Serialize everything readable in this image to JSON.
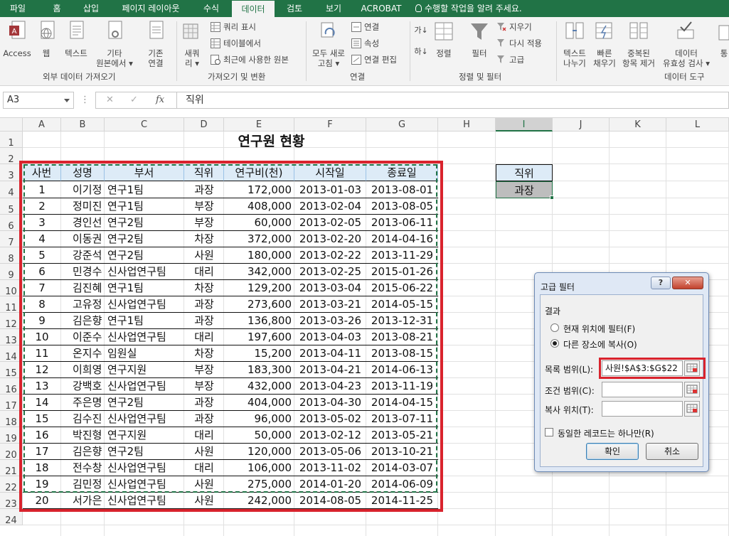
{
  "ribbon": {
    "tabs": [
      "파일",
      "홈",
      "삽입",
      "페이지 레이아웃",
      "수식",
      "데이터",
      "검토",
      "보기",
      "ACROBAT",
      "수행할 작업을 알려 주세요."
    ],
    "active_tab": "데이터",
    "groups": {
      "external": {
        "label": "외부 데이터 가져오기",
        "access": "Access",
        "web": "웹",
        "text": "텍스트",
        "other_line1": "기타",
        "other_line2": "원본에서 ▾"
      },
      "existing": {
        "line1": "기존",
        "line2": "연결"
      },
      "getdata": {
        "label": "가져오기 및 변환",
        "new_query_line1": "새쿼",
        "new_query_line2": "리 ▾",
        "show_queries": "쿼리 표시",
        "from_table": "테이블에서",
        "recent_sources": "최근에 사용한 원본"
      },
      "connections": {
        "label": "연결",
        "refresh_line1": "모두 새로",
        "refresh_line2": "고침 ▾",
        "connections": "연결",
        "properties": "속성",
        "edit_links": "연결 편집"
      },
      "sortfilter": {
        "label": "정렬 및 필터",
        "sort": "정렬",
        "filter": "필터",
        "clear": "지우기",
        "reapply": "다시 적용",
        "advanced": "고급"
      },
      "datatools": {
        "label": "데이터 도구",
        "text_to_cols_line1": "텍스트",
        "text_to_cols_line2": "나누기",
        "flash_fill_line1": "빠른",
        "flash_fill_line2": "채우기",
        "remove_dup_line1": "중복된",
        "remove_dup_line2": "항목 제거",
        "validation_line1": "데이터",
        "validation_line2": "유효성 검사 ▾",
        "consolidate": "통"
      }
    }
  },
  "formula_bar": {
    "name_box": "A3",
    "fx": "fx",
    "content": "직위"
  },
  "sheet": {
    "columns": [
      "A",
      "B",
      "C",
      "D",
      "E",
      "F",
      "G",
      "H",
      "I",
      "J",
      "K",
      "L"
    ],
    "rows": [
      "1",
      "2",
      "3",
      "4",
      "5",
      "6",
      "7",
      "8",
      "9",
      "10",
      "11",
      "12",
      "13",
      "14",
      "15",
      "16",
      "17",
      "18",
      "19",
      "20",
      "21",
      "22",
      "23",
      "24"
    ],
    "title": "연구원 현황",
    "headers": [
      "사번",
      "성명",
      "부서",
      "직위",
      "연구비(천)",
      "시작일",
      "종료일"
    ],
    "records": [
      [
        "1",
        "이기정",
        "연구1팀",
        "과장",
        "172,000",
        "2013-01-03",
        "2013-08-01"
      ],
      [
        "2",
        "정미진",
        "연구1팀",
        "부장",
        "408,000",
        "2013-02-04",
        "2013-08-05"
      ],
      [
        "3",
        "경인선",
        "연구2팀",
        "부장",
        "60,000",
        "2013-02-05",
        "2013-06-11"
      ],
      [
        "4",
        "이동권",
        "연구2팀",
        "차장",
        "372,000",
        "2013-02-20",
        "2014-04-16"
      ],
      [
        "5",
        "강준석",
        "연구2팀",
        "사원",
        "180,000",
        "2013-02-22",
        "2013-11-29"
      ],
      [
        "6",
        "민경수",
        "신사업연구팀",
        "대리",
        "342,000",
        "2013-02-25",
        "2015-01-26"
      ],
      [
        "7",
        "김진혜",
        "연구1팀",
        "차장",
        "129,200",
        "2013-03-04",
        "2015-06-22"
      ],
      [
        "8",
        "고유정",
        "신사업연구팀",
        "과장",
        "273,600",
        "2013-03-21",
        "2014-05-15"
      ],
      [
        "9",
        "김은향",
        "연구1팀",
        "과장",
        "136,800",
        "2013-03-26",
        "2013-12-31"
      ],
      [
        "10",
        "이준수",
        "신사업연구팀",
        "대리",
        "197,600",
        "2013-04-03",
        "2013-08-21"
      ],
      [
        "11",
        "온지수",
        "임원실",
        "차장",
        "15,200",
        "2013-04-11",
        "2013-08-15"
      ],
      [
        "12",
        "이희영",
        "연구지원",
        "부장",
        "183,300",
        "2013-04-21",
        "2014-06-13"
      ],
      [
        "13",
        "강백호",
        "신사업연구팀",
        "부장",
        "432,000",
        "2013-04-23",
        "2013-11-19"
      ],
      [
        "14",
        "주은명",
        "연구2팀",
        "과장",
        "404,000",
        "2013-04-30",
        "2014-04-15"
      ],
      [
        "15",
        "김수진",
        "신사업연구팀",
        "과장",
        "96,000",
        "2013-05-02",
        "2013-07-11"
      ],
      [
        "16",
        "박진형",
        "연구지원",
        "대리",
        "50,000",
        "2013-02-12",
        "2013-05-21"
      ],
      [
        "17",
        "김은향",
        "연구2팀",
        "사원",
        "120,000",
        "2013-05-06",
        "2013-10-21"
      ],
      [
        "18",
        "전수창",
        "신사업연구팀",
        "대리",
        "106,000",
        "2013-11-02",
        "2014-03-07"
      ],
      [
        "19",
        "김민정",
        "신사업연구팀",
        "사원",
        "275,000",
        "2014-01-20",
        "2014-06-09"
      ],
      [
        "20",
        "서가은",
        "신사업연구팀",
        "사원",
        "242,000",
        "2014-08-05",
        "2014-11-25"
      ]
    ],
    "criteria_header": "직위",
    "criteria_value": "과장"
  },
  "dialog": {
    "title": "고급 필터",
    "help": "?",
    "close": "✕",
    "section_result": "결과",
    "opt_inplace": "현재 위치에 필터(F)",
    "opt_copy": "다른 장소에 복사(O)",
    "list_range_label": "목록 범위(L):",
    "list_range_value": "사원!$A$3:$G$22",
    "criteria_range_label": "조건 범위(C):",
    "criteria_range_value": "",
    "copy_to_label": "복사 위치(T):",
    "copy_to_value": "",
    "unique_only": "동일한 레코드는 하나만(R)",
    "ok": "확인",
    "cancel": "취소"
  },
  "colors": {
    "ribbon_green": "#217346",
    "highlight_red": "#d9232d",
    "header_fill": "#ddebf7",
    "criteria_value_fill": "#bdbdbd",
    "dialog_frame": "#dfe8f5"
  }
}
